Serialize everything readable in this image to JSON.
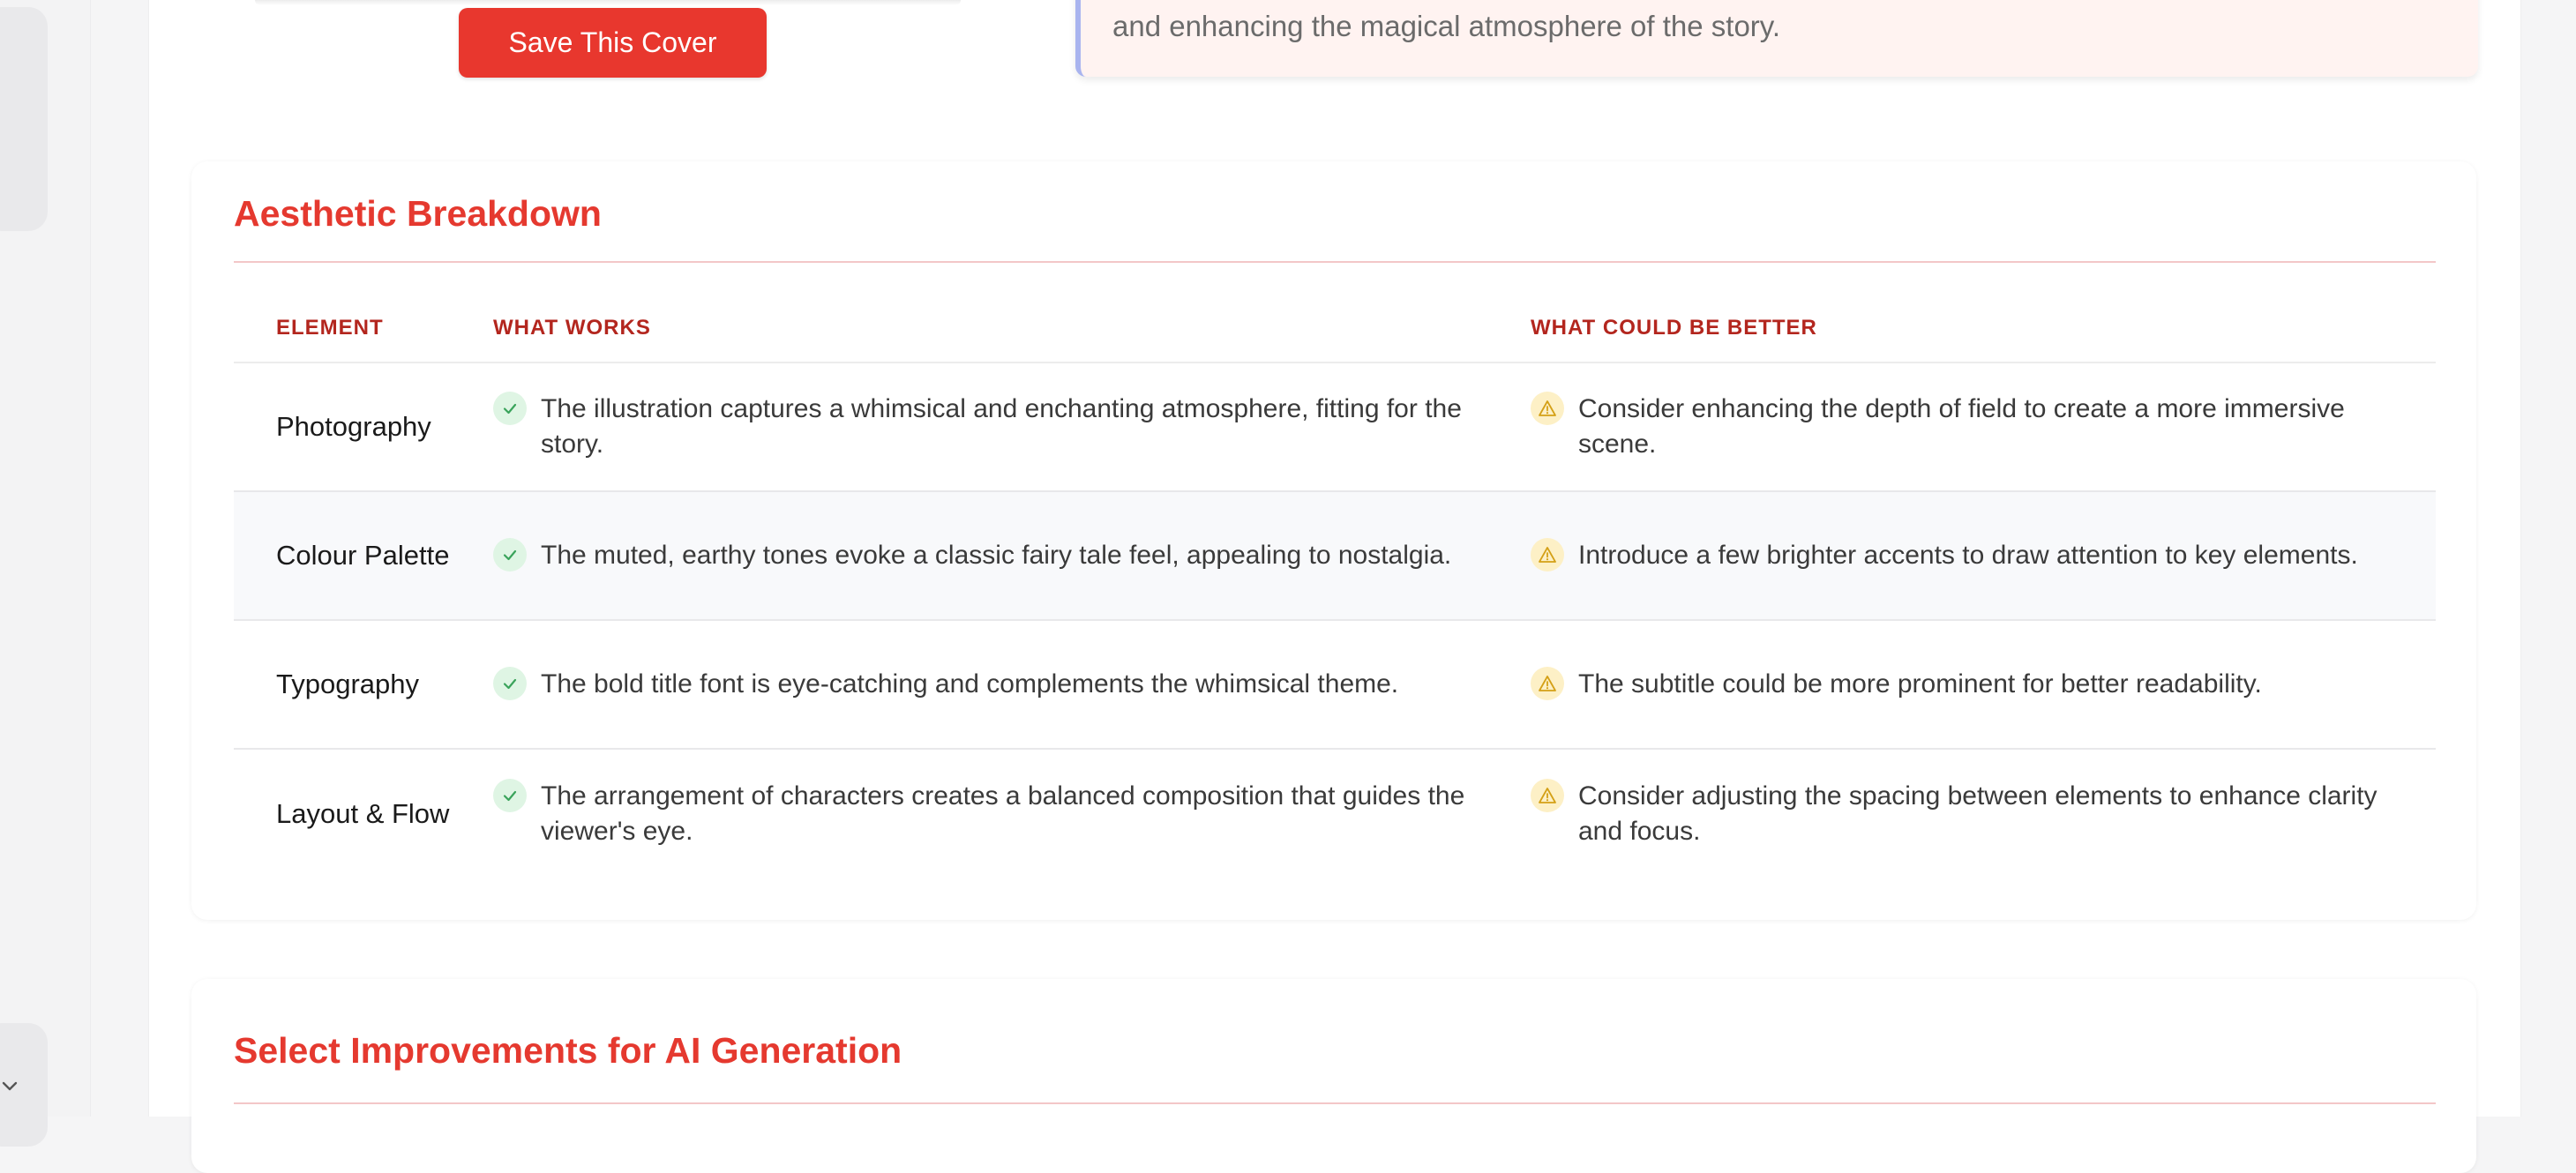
{
  "save_button_label": "Save This Cover",
  "insight_text": "and enhancing the magical atmosphere of the story.",
  "breakdown": {
    "title": "Aesthetic Breakdown",
    "columns": {
      "element": "ELEMENT",
      "works": "WHAT WORKS",
      "better": "WHAT COULD BE BETTER"
    },
    "rows": [
      {
        "element": "Photography",
        "works": "The illustration captures a whimsical and enchanting atmosphere, fitting for the story.",
        "better": "Consider enhancing the depth of field to create a more immersive scene."
      },
      {
        "element": "Colour Palette",
        "works": "The muted, earthy tones evoke a classic fairy tale feel, appealing to nostalgia.",
        "better": "Introduce a few brighter accents to draw attention to key elements."
      },
      {
        "element": "Typography",
        "works": "The bold title font is eye-catching and complements the whimsical theme.",
        "better": "The subtitle could be more prominent for better readability."
      },
      {
        "element": "Layout & Flow",
        "works": "The arrangement of characters creates a balanced composition that guides the viewer's eye.",
        "better": "Consider adjusting the spacing between elements to enhance clarity and focus."
      }
    ]
  },
  "improvements": {
    "title": "Select Improvements for AI Generation"
  },
  "icons": {
    "works": "check-icon",
    "better": "warning-icon",
    "sidebar": "chevron-down-icon"
  },
  "colors": {
    "accent": "#e5392f",
    "header_text": "#b3261e",
    "check": "#3aa35b",
    "warning": "#d4a017"
  }
}
